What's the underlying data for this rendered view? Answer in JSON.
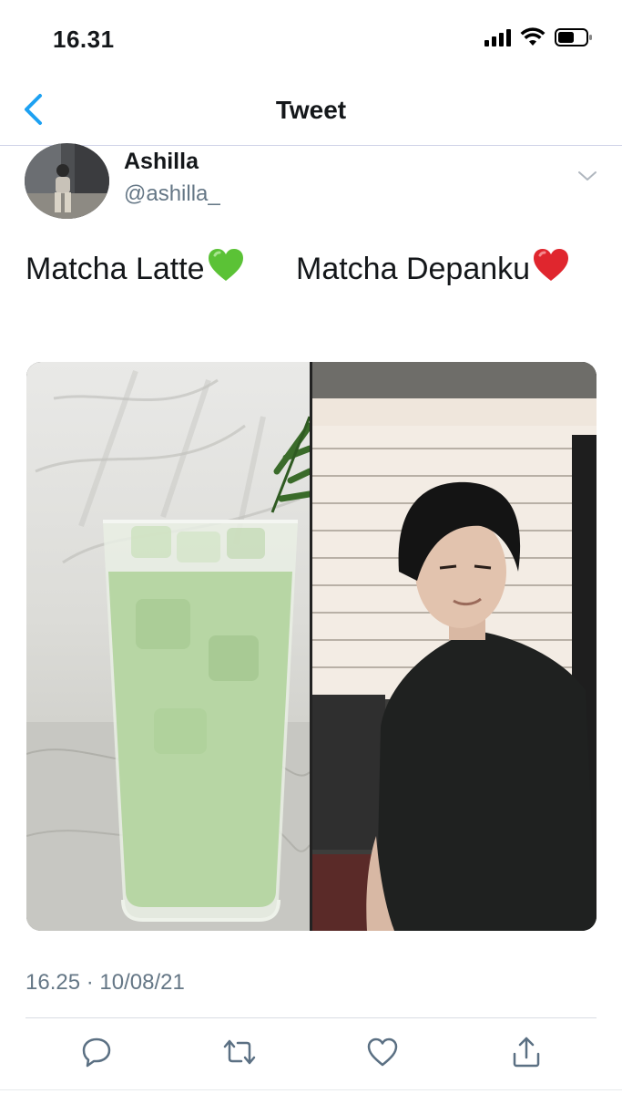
{
  "status_bar": {
    "time": "16.31"
  },
  "nav": {
    "title": "Tweet"
  },
  "author": {
    "name": "Ashilla",
    "handle": "@ashilla_"
  },
  "tweet": {
    "text_left": "Matcha Latte",
    "text_left_emoji": "💚",
    "text_right": "Matcha Depanku",
    "text_right_emoji": "❤️",
    "timestamp": "16.25 · 10/08/21"
  },
  "icons": {
    "back": "chevron-left-icon",
    "more": "chevron-down-icon",
    "reply": "reply-icon",
    "retweet": "retweet-icon",
    "like": "heart-icon",
    "share": "share-icon"
  },
  "colors": {
    "accent": "#1da1f2",
    "secondary_text": "#657786",
    "matcha": "#b9d8a7"
  }
}
